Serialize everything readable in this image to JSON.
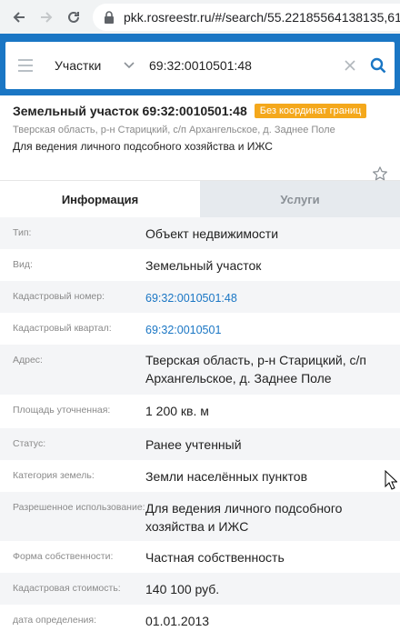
{
  "browser": {
    "url": "pkk.rosreestr.ru/#/search/55.22185564138135,61."
  },
  "search": {
    "layer": "Участки",
    "query": "69:32:0010501:48"
  },
  "object": {
    "title": "Земельный участок 69:32:0010501:48",
    "badge": "Без координат границ",
    "address": "Тверская область, р-н Старицкий, с/п Архангельское, д. Заднее Поле",
    "purpose": "Для ведения личного подсобного хозяйства и ИЖС"
  },
  "tabs": {
    "info": "Информация",
    "services": "Услуги"
  },
  "info_rows": [
    {
      "label": "Тип:",
      "value": "Объект недвижимости",
      "link": false
    },
    {
      "label": "Вид:",
      "value": "Земельный участок",
      "link": false
    },
    {
      "label": "Кадастровый номер:",
      "value": "69:32:0010501:48",
      "link": true
    },
    {
      "label": "Кадастровый квартал:",
      "value": "69:32:0010501",
      "link": true
    },
    {
      "label": "Адрес:",
      "value": "Тверская область, р-н Старицкий, с/п Архангельское, д. Заднее Поле",
      "link": false
    },
    {
      "label": "Площадь уточненная:",
      "value": "1 200 кв. м",
      "link": false
    },
    {
      "label": "Статус:",
      "value": "Ранее учтенный",
      "link": false
    },
    {
      "label": "Категория земель:",
      "value": "Земли населённых пунктов",
      "link": false
    },
    {
      "label": "Разрешенное использование:",
      "value": "Для ведения личного подсобного хозяйства и ИЖС",
      "link": false
    },
    {
      "label": "Форма собственности:",
      "value": "Частная собственность",
      "link": false
    },
    {
      "label": "Кадастровая стоимость:",
      "value": "140 100 руб.",
      "link": false
    },
    {
      "label": "дата определения:",
      "value": "01.01.2013",
      "link": false
    }
  ],
  "colors": {
    "header_blue": "#1a76c4",
    "badge_orange": "#f4a81c",
    "link_blue": "#1a76c4"
  }
}
